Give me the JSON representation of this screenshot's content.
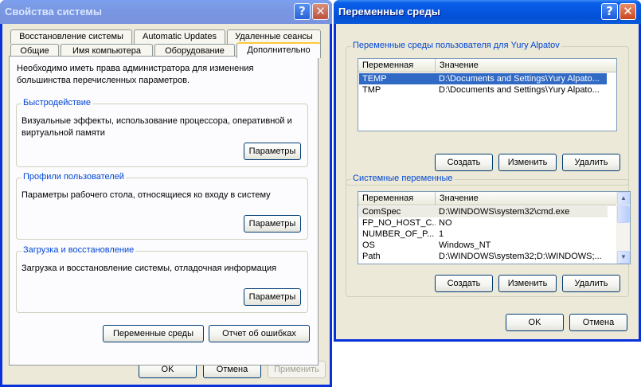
{
  "sysprops": {
    "title": "Свойства системы",
    "help_btn": "?",
    "close_btn": "✕",
    "tabs_row1": [
      "Восстановление системы",
      "Automatic Updates",
      "Удаленные сеансы"
    ],
    "tabs_row2": [
      "Общие",
      "Имя компьютера",
      "Оборудование",
      "Дополнительно"
    ],
    "admin_note": "Необходимо иметь права администратора для изменения большинства перечисленных параметров.",
    "performance": {
      "title": "Быстродействие",
      "desc": "Визуальные эффекты, использование процессора, оперативной и виртуальной памяти",
      "button": "Параметры"
    },
    "profiles": {
      "title": "Профили пользователей",
      "desc": "Параметры рабочего стола, относящиеся ко входу в систему",
      "button": "Параметры"
    },
    "startup": {
      "title": "Загрузка и восстановление",
      "desc": "Загрузка и восстановление системы, отладочная информация",
      "button": "Параметры"
    },
    "env_button": "Переменные среды",
    "error_button": "Отчет об ошибках",
    "ok": "OK",
    "cancel": "Отмена",
    "apply": "Применить"
  },
  "envvars": {
    "title": "Переменные среды",
    "help_btn": "?",
    "close_btn": "✕",
    "user_group_title": "Переменные среды пользователя для Yury Alpatov",
    "system_group_title": "Системные переменные",
    "col_variable": "Переменная",
    "col_value": "Значение",
    "user_vars": [
      {
        "name": "TEMP",
        "value": "D:\\Documents and Settings\\Yury Alpato...",
        "selected": true
      },
      {
        "name": "TMP",
        "value": "D:\\Documents and Settings\\Yury Alpato...",
        "selected": false
      }
    ],
    "system_vars": [
      {
        "name": "ComSpec",
        "value": "D:\\WINDOWS\\system32\\cmd.exe"
      },
      {
        "name": "FP_NO_HOST_C...",
        "value": "NO"
      },
      {
        "name": "NUMBER_OF_P...",
        "value": "1"
      },
      {
        "name": "OS",
        "value": "Windows_NT"
      },
      {
        "name": "Path",
        "value": "D:\\WINDOWS\\system32;D:\\WINDOWS;..."
      }
    ],
    "create": "Создать",
    "edit": "Изменить",
    "delete": "Удалить",
    "ok": "OK",
    "cancel": "Отмена"
  }
}
